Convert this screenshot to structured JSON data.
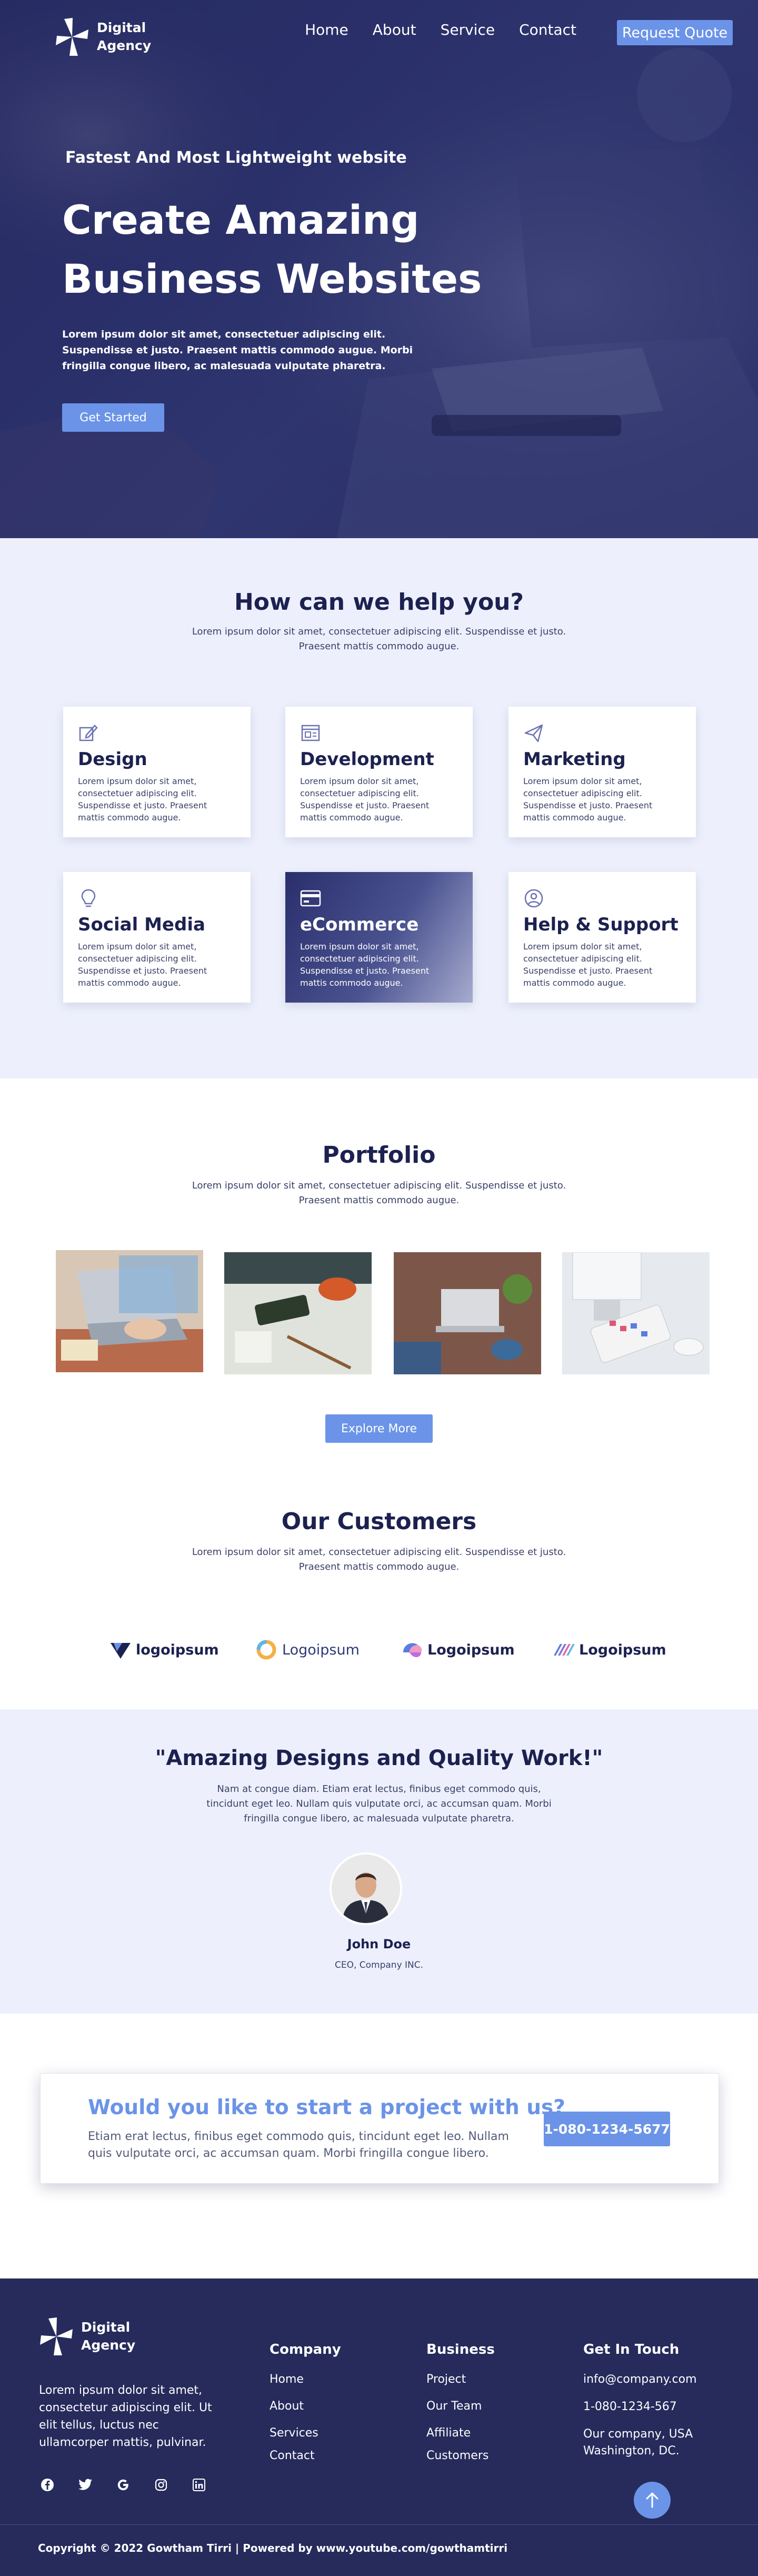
{
  "brand": {
    "name": "Digital Agency",
    "colors": {
      "navy": "#262b5c",
      "accent": "#6b94e8",
      "light_bg": "#edf0fc"
    }
  },
  "nav": {
    "links": [
      "Home",
      "About",
      "Service",
      "Contact"
    ],
    "cta_label": "Request Quote"
  },
  "hero": {
    "kicker": "Fastest And Most Lightweight website",
    "title": "Create Amazing Business Websites",
    "text": "Lorem ipsum dolor sit amet, consectetuer adipiscing elit. Suspendisse et justo. Praesent mattis commodo augue. Morbi fringilla congue libero, ac malesuada vulputate pharetra.",
    "button_label": "Get Started"
  },
  "services": {
    "title": "How can we help you?",
    "subtitle": "Lorem ipsum dolor sit amet, consectetuer adipiscing elit. Suspendisse et justo. Praesent mattis commodo augue.",
    "cards": [
      {
        "icon": "pencil-square-icon",
        "title": "Design",
        "text": "Lorem ipsum dolor sit amet, consectetuer adipiscing elit. Suspendisse et justo. Praesent mattis commodo augue."
      },
      {
        "icon": "code-window-icon",
        "title": "Development",
        "text": "Lorem ipsum dolor sit amet, consectetuer adipiscing elit. Suspendisse et justo. Praesent mattis commodo augue."
      },
      {
        "icon": "paper-plane-icon",
        "title": "Marketing",
        "text": "Lorem ipsum dolor sit amet, consectetuer adipiscing elit. Suspendisse et justo. Praesent mattis commodo augue."
      },
      {
        "icon": "lightbulb-icon",
        "title": "Social Media",
        "text": "Lorem ipsum dolor sit amet, consectetuer adipiscing elit. Suspendisse et justo. Praesent mattis commodo augue."
      },
      {
        "icon": "credit-card-icon",
        "title": "eCommerce",
        "text": "Lorem ipsum dolor sit amet, consectetuer adipiscing elit. Suspendisse et justo. Praesent mattis commodo augue."
      },
      {
        "icon": "user-circle-icon",
        "title": "Help & Support",
        "text": "Lorem ipsum dolor sit amet, consectetuer adipiscing elit. Suspendisse et justo. Praesent mattis commodo augue."
      }
    ]
  },
  "portfolio": {
    "title": "Portfolio",
    "subtitle": "Lorem ipsum dolor sit amet, consectetuer adipiscing elit. Suspendisse et justo. Praesent mattis commodo augue.",
    "button_label": "Explore More"
  },
  "customers": {
    "title": "Our Customers",
    "subtitle": "Lorem ipsum dolor sit amet, consectetuer adipiscing elit. Suspendisse et justo. Praesent mattis commodo augue.",
    "logos": [
      "logoipsum",
      "Logoipsum",
      "Logoipsum",
      "Logoipsum"
    ]
  },
  "testimonial": {
    "quote": "\"Amazing Designs and Quality Work!\"",
    "text": "Nam at congue diam. Etiam erat lectus, finibus eget commodo quis, tincidunt eget leo. Nullam quis vulputate orci, ac accumsan quam. Morbi fringilla congue libero, ac malesuada vulputate pharetra.",
    "name": "John Doe",
    "role": "CEO, Company INC."
  },
  "cta": {
    "title": "Would you like to start a project with us?",
    "text": "Etiam erat lectus, finibus eget commodo quis, tincidunt eget leo. Nullam quis vulputate orci, ac accumsan quam. Morbi fringilla congue libero.",
    "phone": "1-080-1234-5677"
  },
  "footer": {
    "brand": "Digital Agency",
    "about": "Lorem ipsum dolor sit amet, consectetur adipiscing elit. Ut elit tellus, luctus nec ullamcorper mattis, pulvinar.",
    "socials": [
      "facebook-icon",
      "twitter-icon",
      "google-icon",
      "instagram-icon",
      "linkedin-icon"
    ],
    "company": {
      "title": "Company",
      "links": [
        "Home",
        "About",
        "Services",
        "Contact"
      ]
    },
    "business": {
      "title": "Business",
      "links": [
        "Project",
        "Our Team",
        "Affiliate",
        "Customers"
      ]
    },
    "contact": {
      "title": "Get In Touch",
      "email": "info@company.com",
      "phone": "1-080-1234-567",
      "address": "Our company, USA Washington, DC."
    },
    "copyright": "Copyright © 2022 Gowtham Tirri | Powered by www.youtube.com/gowthamtirri"
  }
}
